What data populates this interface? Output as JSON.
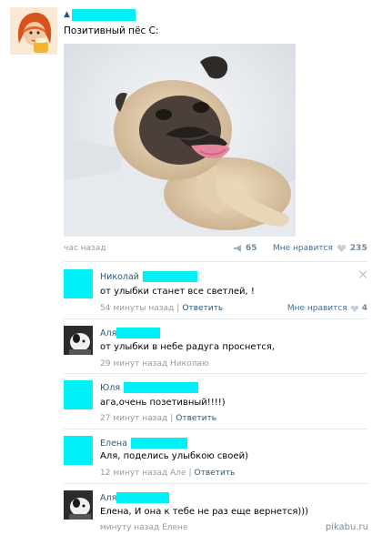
{
  "post": {
    "author_marker": "▲",
    "text": "Позитивный пёс С:",
    "time": "час назад",
    "shares": "65",
    "like_label": "Мне нравится",
    "likes": "235",
    "photo_alt": "pug-photo"
  },
  "comments": [
    {
      "name": "Николай",
      "text": "от улыбки станет все светлей, !",
      "time": "54 минуты назад",
      "reply": "Ответить",
      "like_label": "Мне нравится",
      "likes": "4"
    },
    {
      "name": "Аля",
      "text": "от улыбки в небе радуга проснется,",
      "time": "29 минут назад Николаю"
    },
    {
      "name": "Юля",
      "text": "ага,очень позетивный!!!!)",
      "time": "27 минут назад",
      "reply": "Ответить"
    },
    {
      "name": "Елена",
      "text": "Аля, поделись улыбкою своей)",
      "time": "12 минут назад Але",
      "reply": "Ответить"
    },
    {
      "name": "Аля",
      "text": "Елена, И она к тебе не раз еще вернется)))",
      "time": "минуту назад Елене"
    }
  ],
  "close_icon": "×",
  "watermark": "pikabu.ru",
  "colors": {
    "redaction": "#00f0f8",
    "link": "#2b587a",
    "meta": "#999999"
  }
}
